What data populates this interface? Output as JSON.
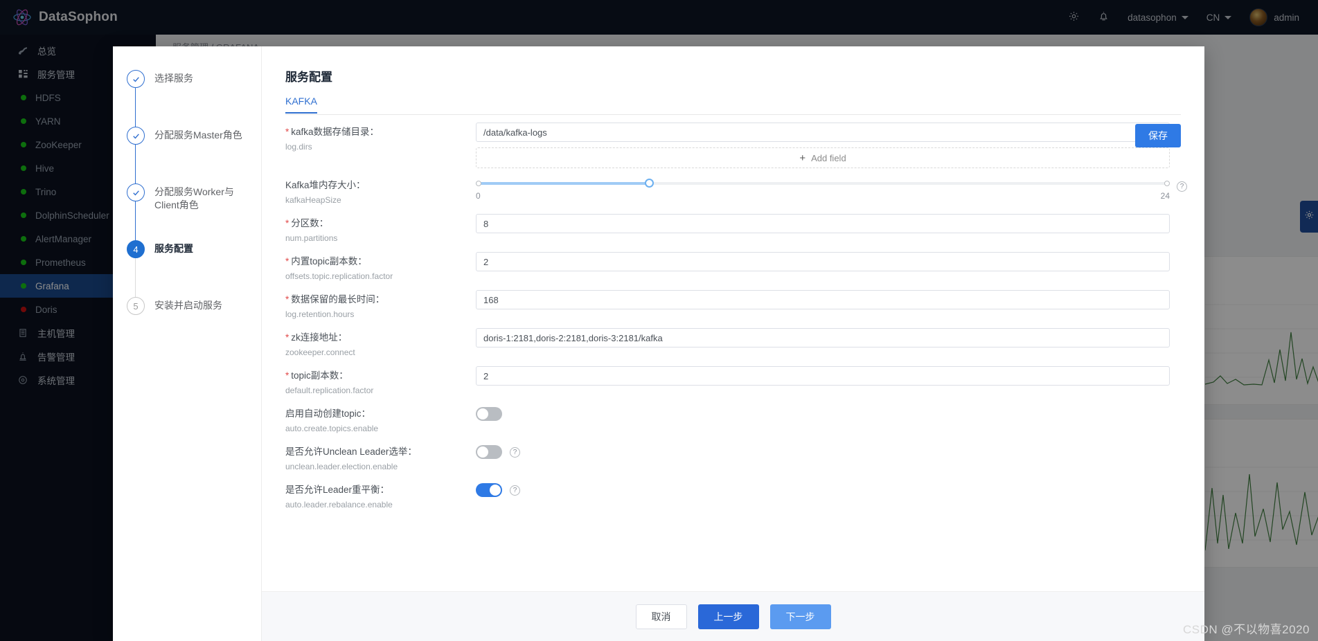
{
  "topbar": {
    "brand": "DataSophon",
    "icons": {
      "settings": "gear-icon",
      "alarm": "bell-icon"
    },
    "tenant": "datasophon",
    "language": "CN",
    "user": "admin"
  },
  "sidebar": {
    "items": [
      {
        "label": "总览",
        "type": "group",
        "icon": "overview-icon",
        "active": false
      },
      {
        "label": "服务管理",
        "type": "group",
        "icon": "service-icon",
        "active": false
      },
      {
        "label": "HDFS",
        "type": "child",
        "status": "green",
        "active": false
      },
      {
        "label": "YARN",
        "type": "child",
        "status": "green",
        "active": false
      },
      {
        "label": "ZooKeeper",
        "type": "child",
        "status": "green",
        "active": false
      },
      {
        "label": "Hive",
        "type": "child",
        "status": "green",
        "active": false
      },
      {
        "label": "Trino",
        "type": "child",
        "status": "green",
        "active": false
      },
      {
        "label": "DolphinScheduler",
        "type": "child",
        "status": "green",
        "active": false
      },
      {
        "label": "AlertManager",
        "type": "child",
        "status": "green",
        "active": false
      },
      {
        "label": "Prometheus",
        "type": "child",
        "status": "green",
        "active": false
      },
      {
        "label": "Grafana",
        "type": "child",
        "status": "green",
        "active": true
      },
      {
        "label": "Doris",
        "type": "child",
        "status": "red",
        "active": false
      },
      {
        "label": "主机管理",
        "type": "group",
        "icon": "host-icon",
        "active": false
      },
      {
        "label": "告警管理",
        "type": "group",
        "icon": "alarm-icon",
        "active": false
      },
      {
        "label": "系统管理",
        "type": "group",
        "icon": "system-icon",
        "active": false
      }
    ]
  },
  "breadcrumb": {
    "parent": "服务管理",
    "separator": "/",
    "current": "GRAFANA"
  },
  "modal": {
    "steps": [
      {
        "num": "1",
        "label": "选择服务",
        "state": "done"
      },
      {
        "num": "2",
        "label": "分配服务Master角色",
        "state": "done"
      },
      {
        "num": "3",
        "label": "分配服务Worker与Client角色",
        "state": "done"
      },
      {
        "num": "4",
        "label": "服务配置",
        "state": "current"
      },
      {
        "num": "5",
        "label": "安装并启动服务",
        "state": "todo"
      }
    ],
    "title": "服务配置",
    "tabs": [
      {
        "label": "KAFKA",
        "active": true
      }
    ],
    "save_label": "保存",
    "add_field_label": "Add field",
    "add_field_plus": "+",
    "fields": [
      {
        "type": "text",
        "required": true,
        "label": "kafka数据存储目录：",
        "key": "log.dirs",
        "value": "/data/kafka-logs",
        "has_add_field": true
      },
      {
        "type": "slider",
        "required": false,
        "label": "Kafka堆内存大小：",
        "key": "kafkaHeapSize",
        "min": "0",
        "max": "24",
        "value": 6,
        "percent": 25,
        "help": true
      },
      {
        "type": "text",
        "required": true,
        "label": "分区数：",
        "key": "num.partitions",
        "value": "8"
      },
      {
        "type": "text",
        "required": true,
        "label": "内置topic副本数：",
        "key": "offsets.topic.replication.factor",
        "value": "2"
      },
      {
        "type": "text",
        "required": true,
        "label": "数据保留的最长时间：",
        "key": "log.retention.hours",
        "value": "168"
      },
      {
        "type": "text",
        "required": true,
        "label": "zk连接地址：",
        "key": "zookeeper.connect",
        "value": "doris-1:2181,doris-2:2181,doris-3:2181/kafka"
      },
      {
        "type": "text",
        "required": true,
        "label": "topic副本数：",
        "key": "default.replication.factor",
        "value": "2"
      },
      {
        "type": "switch",
        "required": false,
        "label": "启用自动创建topic：",
        "key": "auto.create.topics.enable",
        "on": false,
        "help": false
      },
      {
        "type": "switch",
        "required": false,
        "label": "是否允许Unclean Leader选举：",
        "key": "unclean.leader.election.enable",
        "on": false,
        "help": true
      },
      {
        "type": "switch",
        "required": false,
        "label": "是否允许Leader重平衡：",
        "key": "auto.leader.rebalance.enable",
        "on": true,
        "help": true
      }
    ],
    "footer": {
      "cancel": "取消",
      "prev": "上一步",
      "next": "下一步"
    }
  },
  "watermark": "CSDN @不以物喜2020",
  "colors": {
    "accent": "#2f7ae5",
    "topbar_bg": "#0d1626",
    "sidebar_bg": "#0b1220",
    "sidebar_active": "#1b4a8c",
    "status_ok": "#19c819",
    "status_down": "#cc1111",
    "required_star": "#e24a4a"
  }
}
